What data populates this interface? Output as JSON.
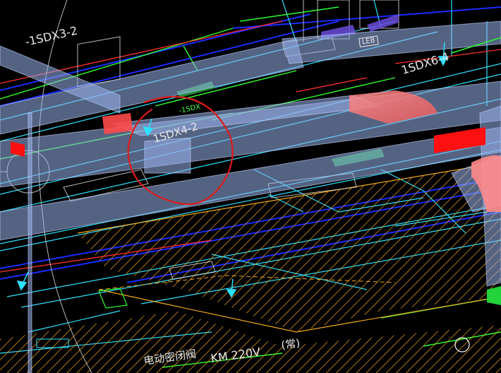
{
  "labels": {
    "ref_1sdx3_2": "-1SDX3-2",
    "ref_1sdx6_4": "1SDX6-4",
    "ref_1sdx4_2": "1SDX4-2",
    "ref_leb": "LEB",
    "ref_1sdx_small": "-1SDX",
    "label_valve": "电动密闭阀",
    "label_power": "KM 220V",
    "label_normal": "(常)"
  },
  "colors": {
    "background": "#000000",
    "duct": "#9ab4ee",
    "cyan_line": "#2ee0ff",
    "blue_line": "#1a2bff",
    "green_line": "#2cff2c",
    "yellow_hatch": "#f2a81a",
    "red_block": "#ff1010",
    "markup_circle": "#e01a1a"
  },
  "icons": [
    "leader-arrow-icon",
    "markup-circle-icon"
  ]
}
